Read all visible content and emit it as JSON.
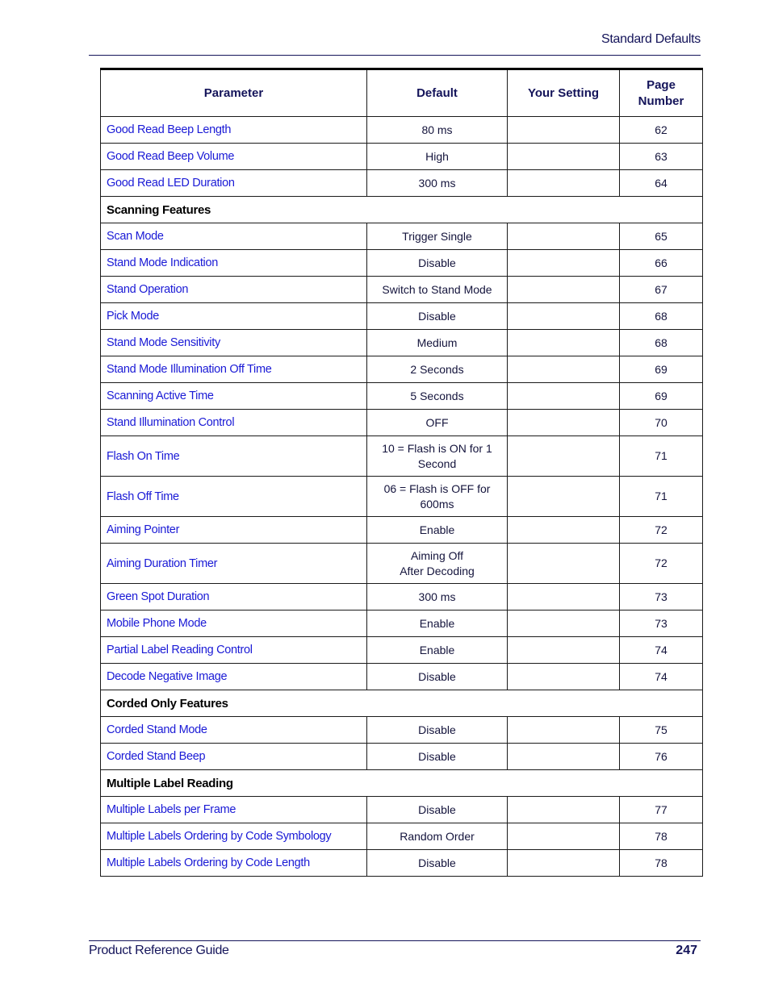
{
  "header": {
    "title": "Standard Defaults"
  },
  "table": {
    "columns": [
      "Parameter",
      "Default",
      "Your Setting",
      "Page Number"
    ],
    "rows": [
      {
        "type": "row",
        "parameter": "Good Read Beep Length",
        "default": "80 ms",
        "setting": "",
        "page": "62"
      },
      {
        "type": "row",
        "parameter": "Good Read Beep Volume",
        "default": "High",
        "setting": "",
        "page": "63"
      },
      {
        "type": "row",
        "parameter": "Good Read LED Duration",
        "default": "300 ms",
        "setting": "",
        "page": "64"
      },
      {
        "type": "section",
        "title": "Scanning Features"
      },
      {
        "type": "row",
        "parameter": "Scan Mode",
        "default": "Trigger Single",
        "setting": "",
        "page": "65"
      },
      {
        "type": "row",
        "parameter": "Stand Mode Indication",
        "default": "Disable",
        "setting": "",
        "page": "66"
      },
      {
        "type": "row",
        "parameter": "Stand Operation",
        "default": "Switch to Stand Mode",
        "setting": "",
        "page": "67"
      },
      {
        "type": "row",
        "parameter": "Pick Mode",
        "default": "Disable",
        "setting": "",
        "page": "68"
      },
      {
        "type": "row",
        "parameter": "Stand Mode Sensitivity",
        "default": "Medium",
        "setting": "",
        "page": "68"
      },
      {
        "type": "row",
        "parameter": "Stand Mode Illumination Off Time",
        "default": "2 Seconds",
        "setting": "",
        "page": "69"
      },
      {
        "type": "row",
        "parameter": "Scanning Active Time",
        "default": "5 Seconds",
        "setting": "",
        "page": "69"
      },
      {
        "type": "row",
        "parameter": "Stand Illumination Control",
        "default": "OFF",
        "setting": "",
        "page": "70"
      },
      {
        "type": "row",
        "tall": true,
        "parameter": "Flash On Time",
        "default": "10 = Flash is ON for 1\nSecond",
        "setting": "",
        "page": "71"
      },
      {
        "type": "row",
        "tall": true,
        "parameter": "Flash Off Time",
        "default": "06 = Flash is OFF for\n600ms",
        "setting": "",
        "page": "71"
      },
      {
        "type": "row",
        "parameter": "Aiming Pointer",
        "default": "Enable",
        "setting": "",
        "page": "72"
      },
      {
        "type": "row",
        "tall": true,
        "parameter": "Aiming Duration Timer",
        "default": "Aiming Off\nAfter Decoding",
        "setting": "",
        "page": "72"
      },
      {
        "type": "row",
        "parameter": "Green Spot Duration",
        "default": "300 ms",
        "setting": "",
        "page": "73"
      },
      {
        "type": "row",
        "parameter": "Mobile Phone Mode",
        "default": "Enable",
        "setting": "",
        "page": "73"
      },
      {
        "type": "row",
        "parameter": "Partial Label Reading Control",
        "default": "Enable",
        "setting": "",
        "page": "74"
      },
      {
        "type": "row",
        "parameter": "Decode Negative Image",
        "default": "Disable",
        "setting": "",
        "page": "74"
      },
      {
        "type": "section",
        "title": "Corded Only Features"
      },
      {
        "type": "row",
        "parameter": "Corded Stand Mode",
        "default": "Disable",
        "setting": "",
        "page": "75"
      },
      {
        "type": "row",
        "parameter": "Corded Stand Beep",
        "default": "Disable",
        "setting": "",
        "page": "76"
      },
      {
        "type": "section",
        "title": "Multiple Label Reading"
      },
      {
        "type": "row",
        "parameter": "Multiple Labels per Frame",
        "default": "Disable",
        "setting": "",
        "page": "77"
      },
      {
        "type": "row",
        "parameter": "Multiple Labels Ordering by Code Symbology",
        "default": "Random Order",
        "setting": "",
        "page": "78"
      },
      {
        "type": "row",
        "parameter": "Multiple Labels Ordering by Code Length",
        "default": "Disable",
        "setting": "",
        "page": "78"
      }
    ]
  },
  "footer": {
    "title": "Product Reference Guide",
    "page_number": "247"
  }
}
